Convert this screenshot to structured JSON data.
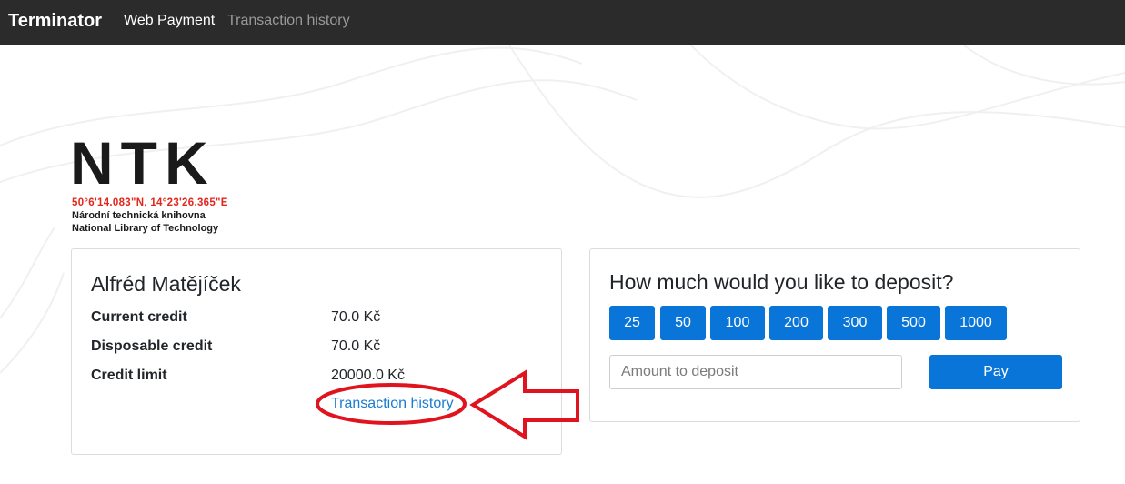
{
  "navbar": {
    "brand": "Terminator",
    "links": [
      {
        "label": "Web Payment",
        "active": true
      },
      {
        "label": "Transaction history",
        "active": false
      }
    ]
  },
  "logo": {
    "wordmark": "NTK",
    "coordinates": "50°6'14.083\"N, 14°23'26.365\"E",
    "line1": "Národní technická knihovna",
    "line2": "National Library of Technology"
  },
  "account": {
    "name": "Alfréd Matějíček",
    "rows": [
      {
        "label": "Current credit",
        "value": "70.0 Kč"
      },
      {
        "label": "Disposable credit",
        "value": "70.0 Kč"
      },
      {
        "label": "Credit limit",
        "value": "20000.0 Kč"
      }
    ],
    "history_link": "Transaction history"
  },
  "deposit": {
    "title": "How much would you like to deposit?",
    "amounts": [
      "25",
      "50",
      "100",
      "200",
      "300",
      "500",
      "1000"
    ],
    "input_placeholder": "Amount to deposit",
    "input_value": "",
    "pay_label": "Pay"
  },
  "colors": {
    "navbar_bg": "#2b2b2b",
    "primary": "#0a75d8",
    "link": "#1a7bd1",
    "annotation_red": "#e0141e",
    "logo_red": "#e3261b"
  },
  "icons": {
    "annotation": "arrow-left-icon"
  }
}
